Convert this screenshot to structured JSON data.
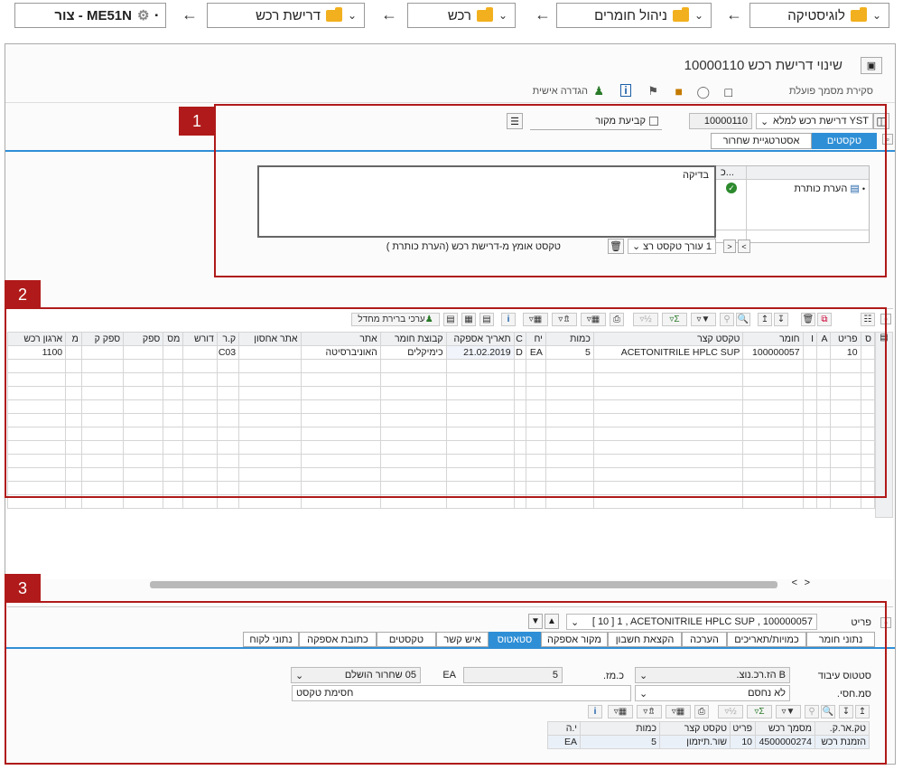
{
  "breadcrumb": {
    "items": [
      {
        "label": "לוגיסטיקה"
      },
      {
        "label": "ניהול חומרים"
      },
      {
        "label": "רכש"
      },
      {
        "label": "דרישת רכש"
      }
    ],
    "tcode": "ME51N - צור"
  },
  "window": {
    "title": "שינוי דרישת רכש 10000110",
    "toolbar": {
      "close_doc": "סקירת מסמך פועלת",
      "personal": "הגדרה אישית"
    }
  },
  "section_labels": [
    "1",
    "2",
    "3"
  ],
  "header": {
    "doc_type": "YST דרישת רכש למלא",
    "doc_number": "10000110",
    "source_det": "קביעת מקור",
    "tabs": [
      "טקסטים",
      "אסטרטגיית שחרור"
    ],
    "text_tree_col": "כ...",
    "text_tree_item": "הערת כותרת",
    "text_content": "בדיקה",
    "editor_select": "1 עורך טקסט רצ",
    "adopted_text": "טקסט אומץ מ-דרישת רכש (הערת כותרת )"
  },
  "items_grid": {
    "toolbar_default": "ערכי ברירת מחדל",
    "columns": [
      "ס",
      "פריט",
      "A",
      "I",
      "חומר",
      "טקסט קצר",
      "כמות",
      "יח",
      "C",
      "תאריך אספקה",
      "קבוצת חומר",
      "אתר",
      "אתר אחסון",
      "ק.ר",
      "דורש",
      "מס",
      "ספק",
      "ספק ק",
      "מ",
      "ארגון רכש"
    ],
    "rows": [
      [
        "",
        "10",
        "",
        "",
        "100000057",
        "ACETONITRILE HPLC SUP",
        "5",
        "EA",
        "D",
        "21.02.2019",
        "כימיקלים",
        "האוניברסיטה",
        "",
        "C03",
        "",
        "",
        "",
        "",
        "",
        "1100"
      ]
    ]
  },
  "item_detail": {
    "item_label": "פריט",
    "item_select": "[ 10 ] 1 , ACETONITRILE HPLC SUP , 100000057",
    "tabs": [
      "נתוני חומר",
      "כמויות/תאריכים",
      "הערכה",
      "הקצאת חשבון",
      "מקור אספקה",
      "סטאטוס",
      "איש קשר",
      "טקסטים",
      "כתובת אספקה",
      "נתוני לקוח"
    ],
    "active_tab": "סטאטוס",
    "processing_status_label": "סטטוס עיבוד",
    "processing_status_value": "B הז.רכ.נוצ.",
    "qty_label": "כ.מז.",
    "qty_value": "5",
    "unit_value": "EA",
    "release_value": "05 שחרור הושלם",
    "blocked_label": "סמ.חסי.",
    "blocked_value": "לא נחסם",
    "block_text_label": "חסימת טקסט",
    "po_table": {
      "columns": [
        "טק.אר.ק.",
        "מסמך רכש",
        "פריט",
        "טקסט קצר",
        "כמות",
        "י.ה"
      ],
      "rows": [
        [
          "הזמנת רכש",
          "4500000274",
          "10",
          "שור.תיזמון",
          "5",
          "EA"
        ]
      ]
    }
  }
}
